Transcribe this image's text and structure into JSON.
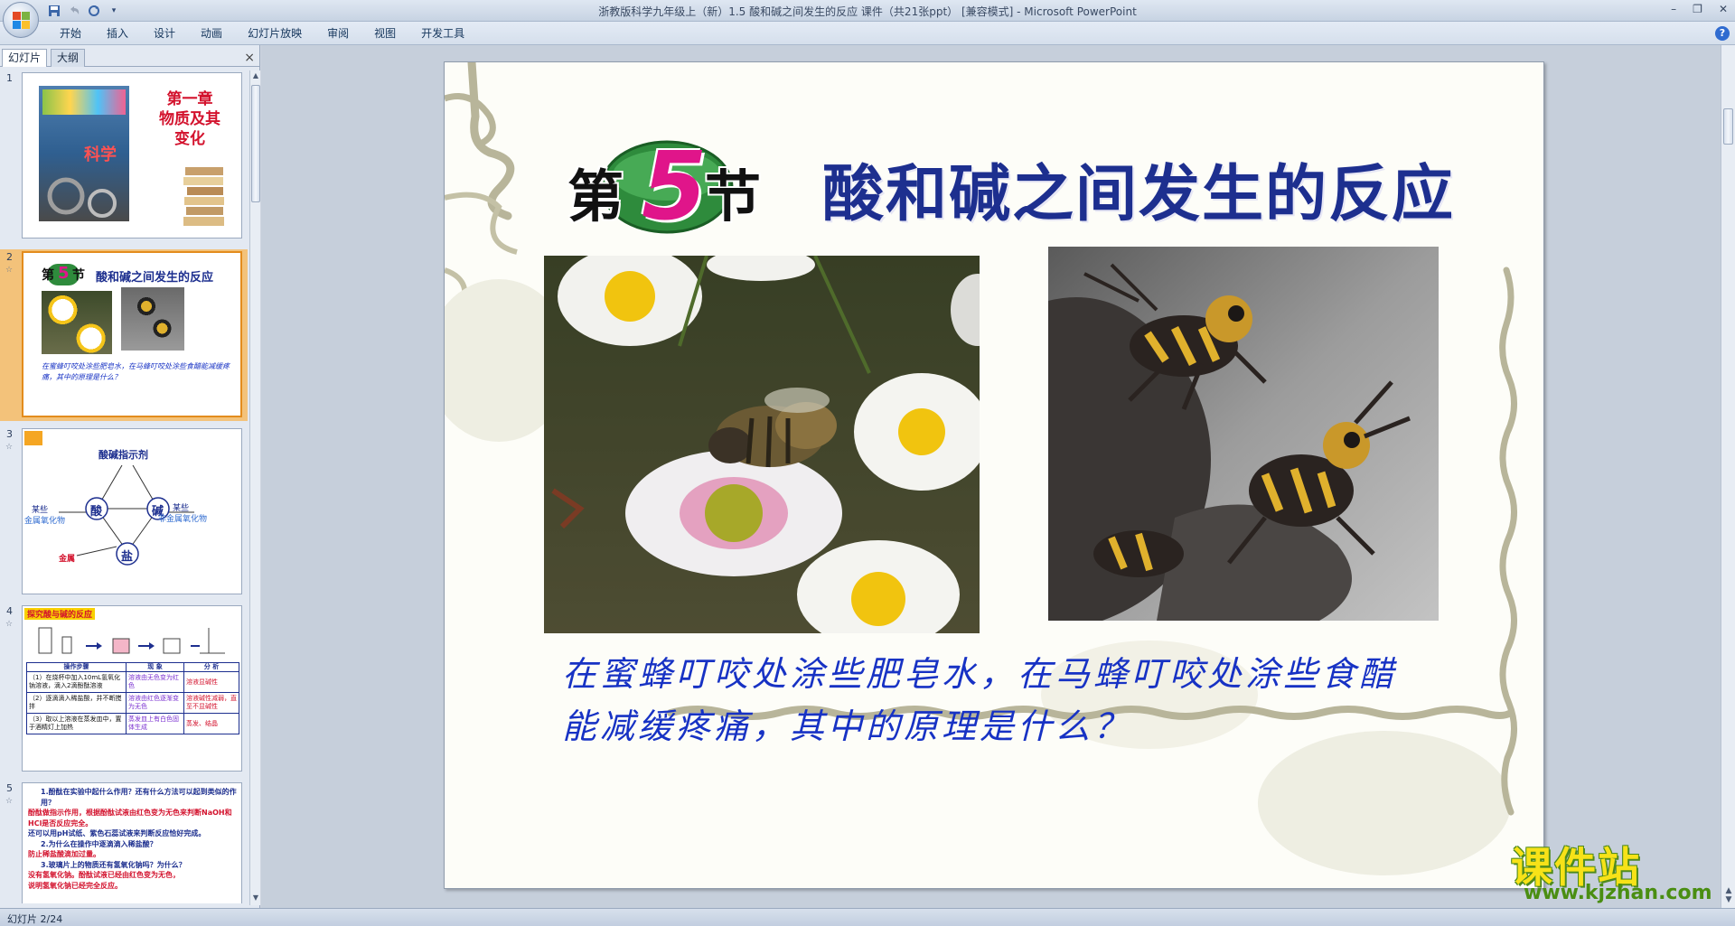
{
  "window": {
    "title": "浙教版科学九年级上（新）1.5 酸和碱之间发生的反应 课件（共21张ppt） [兼容模式] - Microsoft PowerPoint"
  },
  "ribbon": {
    "tabs": [
      "开始",
      "插入",
      "设计",
      "动画",
      "幻灯片放映",
      "审阅",
      "视图",
      "开发工具"
    ]
  },
  "left_panel": {
    "tabs": [
      "幻灯片",
      "大纲"
    ],
    "close_icon": "×",
    "thumbnails": [
      {
        "number": "1",
        "title_lines": [
          "第一章",
          "物质及其",
          "变化"
        ],
        "book_label": "科学"
      },
      {
        "number": "2",
        "badge_char": "5",
        "badge_left": "第",
        "badge_right": "节",
        "title": "酸和碱之间发生的反应",
        "caption": "在蜜蜂叮咬处涂些肥皂水，在马蜂叮咬处涂些食醋能减缓疼痛，其中的原理是什么？"
      },
      {
        "number": "3",
        "top_label": "酸碱指示剂",
        "acid": "酸",
        "base": "碱",
        "salt": "盐",
        "left_label_1": "某些",
        "left_label_2": "金属氧化物",
        "right_label_1": "某些",
        "right_label_2": "非金属氧化物",
        "bottom_label": "金属"
      },
      {
        "number": "4",
        "heading": "探究酸与碱的反应",
        "table_headers": [
          "操作步骤",
          "现 象",
          "分 析"
        ],
        "rows": [
          [
            "（1）在烧杯中加入10mL氢氧化钠溶液，滴入2滴酚酞溶液",
            "溶液由无色变为红色",
            "溶液显碱性"
          ],
          [
            "（2）逐滴滴入稀盐酸，并不断搅拌",
            "溶液由红色逐渐变为无色",
            "溶液碱性减弱，直至不显碱性"
          ],
          [
            "（3）取以上溶液在蒸发皿中，置于酒精灯上加热",
            "蒸发皿上有白色固体生成",
            "蒸发、结晶"
          ]
        ]
      },
      {
        "number": "5",
        "lines": [
          "1.酚酞在实验中起什么作用？还有什么方法可以起到类似的作用？",
          "酚酞做指示作用，根据酚酞试液由红色变为无色来判断NaOH和HCl是否反应完全。",
          "还可以用pH试纸、紫色石蕊试液来判断反应恰好完成。",
          "2.为什么在操作中逐滴滴入稀盐酸？",
          "防止稀盐酸滴加过量。",
          "3.玻璃片上的物质还有氢氧化钠吗？为什么？",
          "没有氢氧化钠。酚酞试液已经由红色变为无色，",
          "说明氢氧化钠已经完全反应。"
        ]
      }
    ]
  },
  "slide": {
    "badge_left": "第",
    "badge_number": "5",
    "badge_right": "节",
    "title": "酸和碱之间发生的反应",
    "question": "在蜜蜂叮咬处涂些肥皂水，在马蜂叮咬处涂些食醋能减缓疼痛，其中的原理是什么？"
  },
  "status": {
    "slide_position": "幻灯片 2/24"
  },
  "watermark": {
    "name": "课件站",
    "url": "www.kjzhan.com"
  },
  "colors": {
    "title_blue": "#1d2f8f",
    "question_blue": "#1732c4",
    "badge_green": "#2e8b3c",
    "badge_magenta": "#e0158a",
    "selected_orange": "#e38c1d"
  }
}
